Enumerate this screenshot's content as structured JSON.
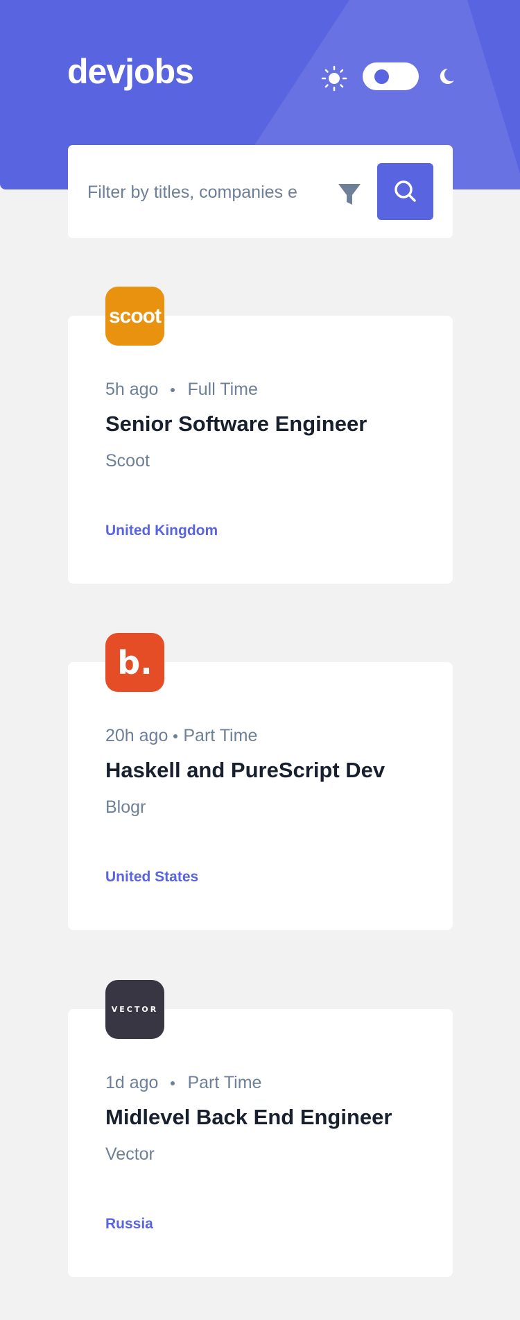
{
  "header": {
    "brand": "devjobs",
    "theme_toggle": "light"
  },
  "search": {
    "placeholder": "Filter by titles, companies e",
    "value": ""
  },
  "colors": {
    "accent": "#5964e0",
    "text": "#19202d",
    "muted": "#6e8098",
    "background": "#f2f2f2"
  },
  "jobs": [
    {
      "logo_text": "scoot",
      "logo_color": "#e99210",
      "posted": "5h ago",
      "contract": "Full Time",
      "position": "Senior Software Engineer",
      "company": "Scoot",
      "location": "United Kingdom"
    },
    {
      "logo_text": "b.",
      "logo_color": "#e54d26",
      "posted": "20h ago",
      "contract": "Part Time",
      "position": "Haskell and PureScript Dev",
      "company": "Blogr",
      "location": "United States"
    },
    {
      "logo_text": "VECTOR",
      "logo_color": "#373642",
      "posted": "1d ago",
      "contract": "Part Time",
      "position": "Midlevel Back End Engineer",
      "company": "Vector",
      "location": "Russia"
    }
  ]
}
